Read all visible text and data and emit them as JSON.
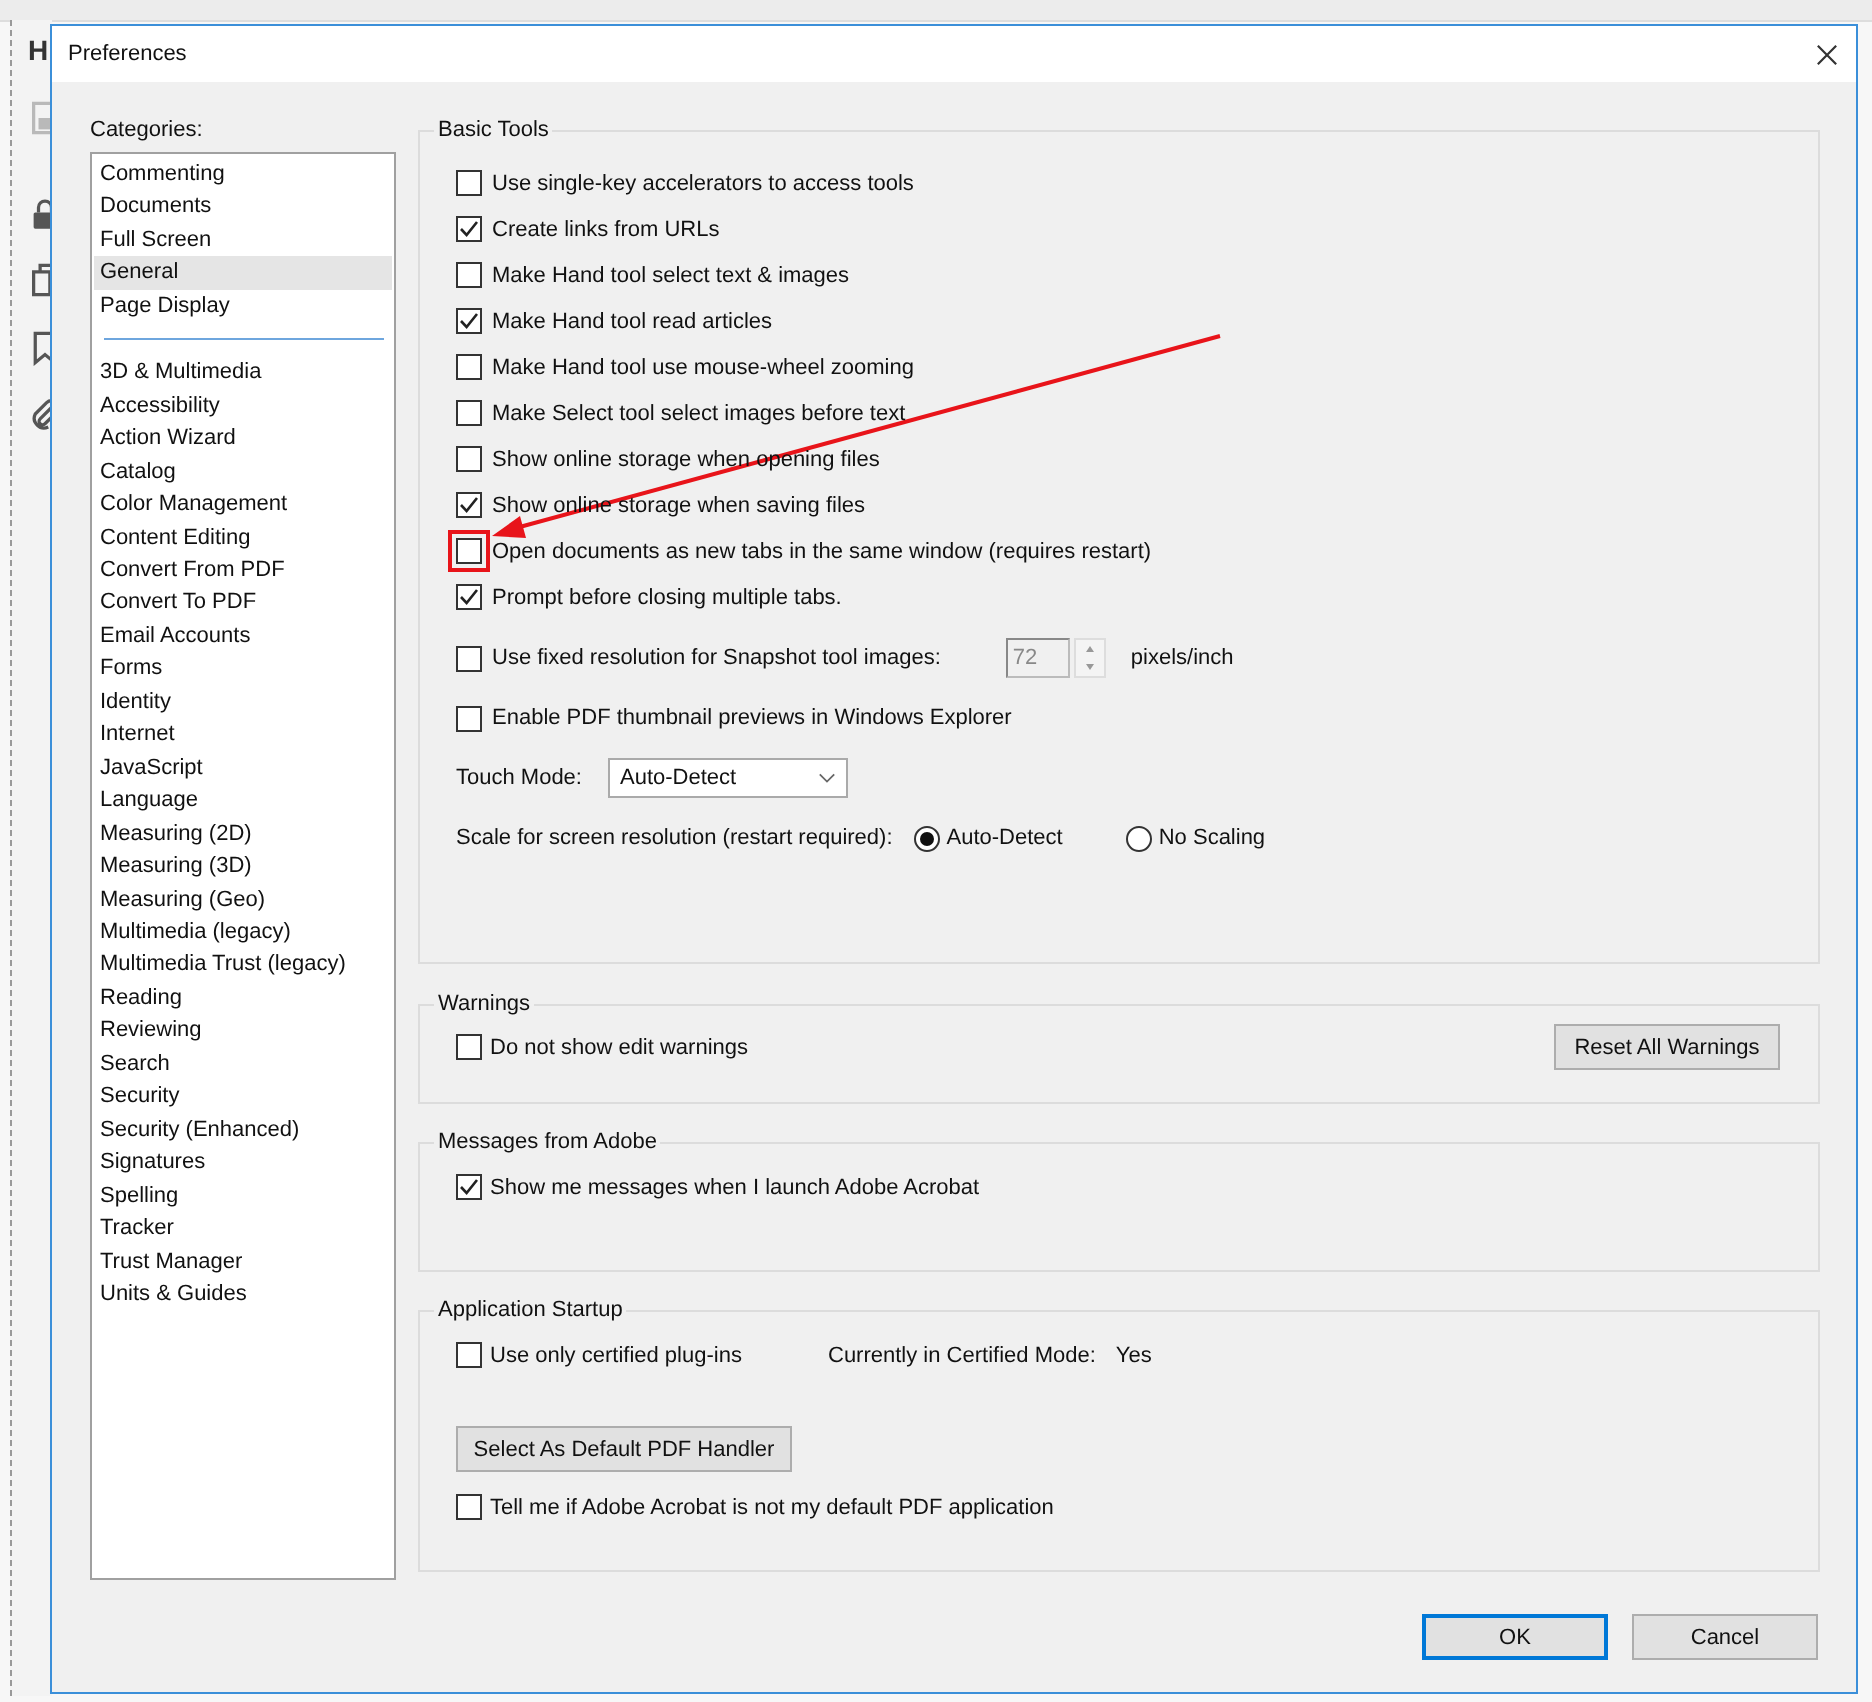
{
  "background": {
    "tab_label": "H"
  },
  "dialog": {
    "title": "Preferences"
  },
  "categories": {
    "label": "Categories:",
    "groups": [
      [
        {
          "label": "Commenting",
          "selected": false
        },
        {
          "label": "Documents",
          "selected": false
        },
        {
          "label": "Full Screen",
          "selected": false
        },
        {
          "label": "General",
          "selected": true
        },
        {
          "label": "Page Display",
          "selected": false
        }
      ],
      [
        {
          "label": "3D & Multimedia",
          "selected": false
        },
        {
          "label": "Accessibility",
          "selected": false
        },
        {
          "label": "Action Wizard",
          "selected": false
        },
        {
          "label": "Catalog",
          "selected": false
        },
        {
          "label": "Color Management",
          "selected": false
        },
        {
          "label": "Content Editing",
          "selected": false
        },
        {
          "label": "Convert From PDF",
          "selected": false
        },
        {
          "label": "Convert To PDF",
          "selected": false
        },
        {
          "label": "Email Accounts",
          "selected": false
        },
        {
          "label": "Forms",
          "selected": false
        },
        {
          "label": "Identity",
          "selected": false
        },
        {
          "label": "Internet",
          "selected": false
        },
        {
          "label": "JavaScript",
          "selected": false
        },
        {
          "label": "Language",
          "selected": false
        },
        {
          "label": "Measuring (2D)",
          "selected": false
        },
        {
          "label": "Measuring (3D)",
          "selected": false
        },
        {
          "label": "Measuring (Geo)",
          "selected": false
        },
        {
          "label": "Multimedia (legacy)",
          "selected": false
        },
        {
          "label": "Multimedia Trust (legacy)",
          "selected": false
        },
        {
          "label": "Reading",
          "selected": false
        },
        {
          "label": "Reviewing",
          "selected": false
        },
        {
          "label": "Search",
          "selected": false
        },
        {
          "label": "Security",
          "selected": false
        },
        {
          "label": "Security (Enhanced)",
          "selected": false
        },
        {
          "label": "Signatures",
          "selected": false
        },
        {
          "label": "Spelling",
          "selected": false
        },
        {
          "label": "Tracker",
          "selected": false
        },
        {
          "label": "Trust Manager",
          "selected": false
        },
        {
          "label": "Units & Guides",
          "selected": false
        }
      ]
    ]
  },
  "basic_tools": {
    "title": "Basic Tools",
    "options": [
      {
        "kind": "checkbox",
        "label": "Use single-key accelerators to access tools",
        "checked": false,
        "highlighted": false
      },
      {
        "kind": "checkbox",
        "label": "Create links from URLs",
        "checked": true,
        "highlighted": false
      },
      {
        "kind": "checkbox",
        "label": "Make Hand tool select text & images",
        "checked": false,
        "highlighted": false
      },
      {
        "kind": "checkbox",
        "label": "Make Hand tool read articles",
        "checked": true,
        "highlighted": false
      },
      {
        "kind": "checkbox",
        "label": "Make Hand tool use mouse-wheel zooming",
        "checked": false,
        "highlighted": false
      },
      {
        "kind": "checkbox",
        "label": "Make Select tool select images before text",
        "checked": false,
        "highlighted": false
      },
      {
        "kind": "checkbox",
        "label": "Show online storage when opening files",
        "checked": false,
        "highlighted": false
      },
      {
        "kind": "checkbox",
        "label": "Show online storage when saving files",
        "checked": true,
        "highlighted": false
      },
      {
        "kind": "checkbox",
        "label": "Open documents as new tabs in the same window (requires restart)",
        "checked": false,
        "highlighted": true
      },
      {
        "kind": "checkbox",
        "label": "Prompt before closing multiple tabs.",
        "checked": true,
        "highlighted": false
      },
      {
        "kind": "spin",
        "label": "Use fixed resolution for Snapshot tool images:",
        "checked": false,
        "highlighted": false,
        "value": "72",
        "unit": "pixels/inch",
        "disabled": true
      },
      {
        "kind": "checkbox",
        "label": "Enable PDF thumbnail previews in Windows Explorer",
        "checked": false,
        "highlighted": false
      }
    ],
    "touch_mode": {
      "label": "Touch Mode:",
      "value": "Auto-Detect"
    },
    "scale": {
      "label": "Scale for screen resolution (restart required):",
      "options": [
        {
          "label": "Auto-Detect",
          "selected": true
        },
        {
          "label": "No Scaling",
          "selected": false
        }
      ]
    }
  },
  "warnings": {
    "title": "Warnings",
    "option": {
      "label": "Do not show edit warnings",
      "checked": false
    },
    "button": "Reset All Warnings"
  },
  "messages": {
    "title": "Messages from Adobe",
    "option": {
      "label": "Show me messages when I launch Adobe Acrobat",
      "checked": true
    }
  },
  "startup": {
    "title": "Application Startup",
    "option": {
      "label": "Use only certified plug-ins",
      "checked": false
    },
    "mode_label": "Currently in Certified Mode:",
    "mode_value": "Yes",
    "button": "Select As Default PDF Handler",
    "option2": {
      "label": "Tell me if Adobe Acrobat is not my default PDF application",
      "checked": false
    }
  },
  "buttons": [
    {
      "label": "OK",
      "default": true
    },
    {
      "label": "Cancel",
      "default": false
    }
  ]
}
